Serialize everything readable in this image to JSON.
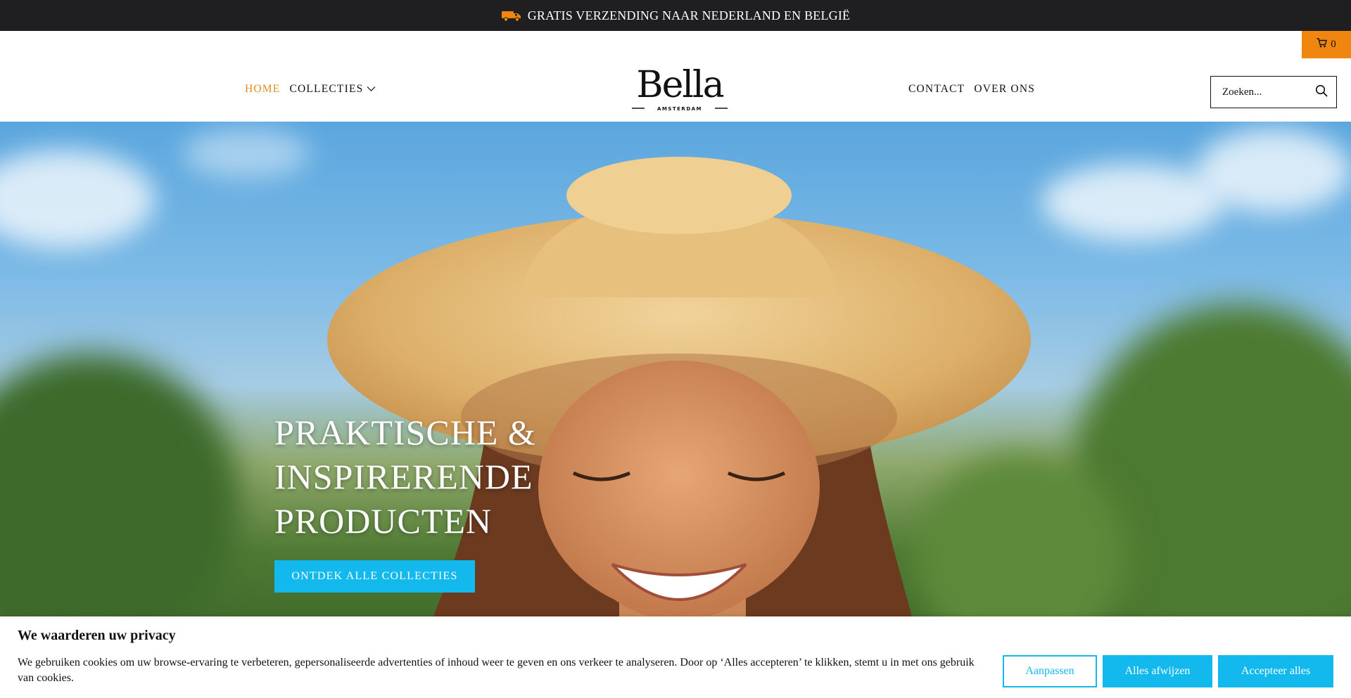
{
  "announcement": {
    "text": "GRATIS VERZENDING NAAR NEDERLAND EN BELGIË",
    "icon": "truck-icon"
  },
  "cart": {
    "icon": "cart-icon",
    "count": "0"
  },
  "nav": {
    "left": [
      {
        "label": "HOME",
        "active": true
      },
      {
        "label": "COLLECTIES",
        "has_dropdown": true
      }
    ],
    "right": [
      {
        "label": "CONTACT"
      },
      {
        "label": "OVER ONS"
      }
    ]
  },
  "logo": {
    "name": "Bella",
    "tagline": "AMSTERDAM"
  },
  "search": {
    "placeholder": "Zoeken...",
    "icon": "search-icon"
  },
  "hero": {
    "title": "PRAKTISCHE &\nINSPIRERENDE\nPRODUCTEN",
    "cta_label": "ONTDEK ALLE COLLECTIES"
  },
  "cookie": {
    "title": "We waarderen uw privacy",
    "text": "We gebruiken cookies om uw browse-ervaring te verbeteren, gepersonaliseerde advertenties of inhoud weer te geven en ons verkeer te analyseren. Door op ‘Alles accepteren’ te klikken, stemt u in met ons gebruik van cookies.",
    "customize_label": "Aanpassen",
    "reject_label": "Alles afwijzen",
    "accept_label": "Accepteer alles"
  },
  "colors": {
    "accent_orange": "#f0860f",
    "nav_active": "#e08a1d",
    "cta_blue": "#13b9ec",
    "announce_bg": "#1f1f22"
  }
}
